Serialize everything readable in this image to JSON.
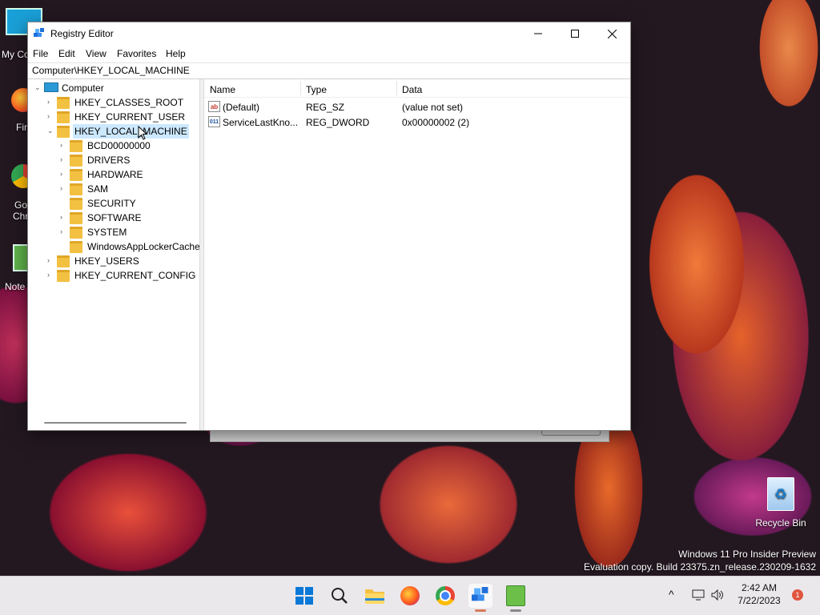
{
  "window": {
    "title": "Registry Editor",
    "minimize": "—",
    "maximize": "☐",
    "close": "✕"
  },
  "menu": [
    "File",
    "Edit",
    "View",
    "Favorites",
    "Help"
  ],
  "address": "Computer\\HKEY_LOCAL_MACHINE",
  "tree": {
    "root": "Computer",
    "hives": [
      "HKEY_CLASSES_ROOT",
      "HKEY_CURRENT_USER",
      "HKEY_LOCAL_MACHINE",
      "HKEY_USERS",
      "HKEY_CURRENT_CONFIG"
    ],
    "hklm_children": [
      "BCD00000000",
      "DRIVERS",
      "HARDWARE",
      "SAM",
      "SECURITY",
      "SOFTWARE",
      "SYSTEM",
      "WindowsAppLockerCache"
    ],
    "selected": "HKEY_LOCAL_MACHINE"
  },
  "list": {
    "columns": [
      "Name",
      "Type",
      "Data"
    ],
    "rows": [
      {
        "icon": "ab",
        "name": "(Default)",
        "type": "REG_SZ",
        "data": "(value not set)"
      },
      {
        "icon": "011",
        "name": "ServiceLastKno...",
        "type": "REG_DWORD",
        "data": "0x00000002 (2)"
      }
    ]
  },
  "desktop": {
    "icons_partial": [
      "My Co",
      "Fir",
      "Go",
      "Chr",
      "Note"
    ],
    "recycle_bin": "Recycle Bin",
    "watermark_line1": "Windows 11 Pro Insider Preview",
    "watermark_line2": "Evaluation copy. Build 23375.zn_release.230209-1632"
  },
  "taskbar": {
    "time": "2:42 AM",
    "date": "7/22/2023",
    "notification_count": "1",
    "chevron": "^"
  }
}
